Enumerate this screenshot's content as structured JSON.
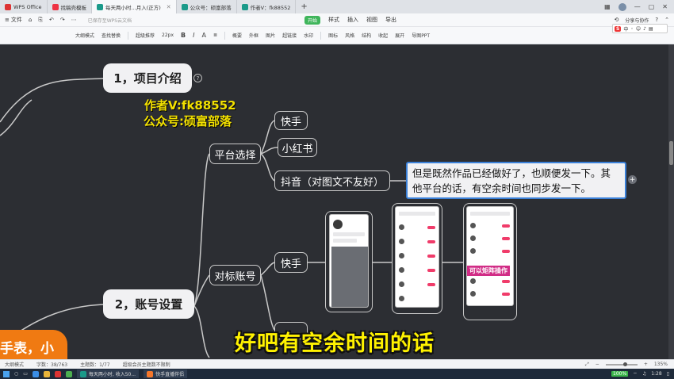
{
  "tabs": [
    {
      "label": "WPS Office",
      "color": "#d33"
    },
    {
      "label": "找稿壳模板",
      "color": "#e34"
    },
    {
      "label": "每天两小时...月入(正方)",
      "color": "#1b9a8a",
      "active": true
    },
    {
      "label": "公众号：硕富部落",
      "color": "#1b9a8a"
    },
    {
      "label": "作者V：fk88552",
      "color": "#1b9a8a"
    }
  ],
  "toolbar1": {
    "file": "文件",
    "saved": "已保存至WPS云文档",
    "start": "开始",
    "menu": [
      "样式",
      "插入",
      "视图",
      "导出"
    ],
    "share": "分享与协作"
  },
  "toolbar2": {
    "items": [
      "大纲模式",
      "查找替换",
      "超级推荐",
      "22px",
      "B",
      "I",
      "A",
      "概要",
      "外框",
      "图片",
      "超链接",
      "水印",
      "图标",
      "风格",
      "结构",
      "收起",
      "展开",
      "导图PPT"
    ]
  },
  "ime": {
    "logo": "S",
    "lang": "中"
  },
  "mindmap": {
    "section1": "1，项目介绍",
    "section2": "2，账号设置",
    "author_line1": "作者V:fk88552",
    "author_line2": "公众号:硕富部落",
    "platform": "平台选择",
    "platform_items": [
      "快手",
      "小红书",
      "抖音（对图文不友好）"
    ],
    "note": "但是既然作品已经做好了，也顺便发一下。其他平台的话，有空余时间也同步发一下。",
    "benchmark": "对标账号",
    "benchmark_item": "快手",
    "matrix_label": "可以矩阵操作",
    "left_fragment": "手表，小",
    "help_glyph": "?",
    "plus_glyph": "+"
  },
  "subtitle": "好吧有空余时间的话",
  "status": {
    "outline": "大纲模式",
    "words": "字数：38/763",
    "topics": "主题数：1/77",
    "member": "超级会员主题数不限制",
    "zoom": "135%"
  },
  "taskbar": {
    "app1": "每天两小时, 收入50...",
    "app2": "快手直播伴侣",
    "battery": "100%",
    "time": "1:28"
  }
}
